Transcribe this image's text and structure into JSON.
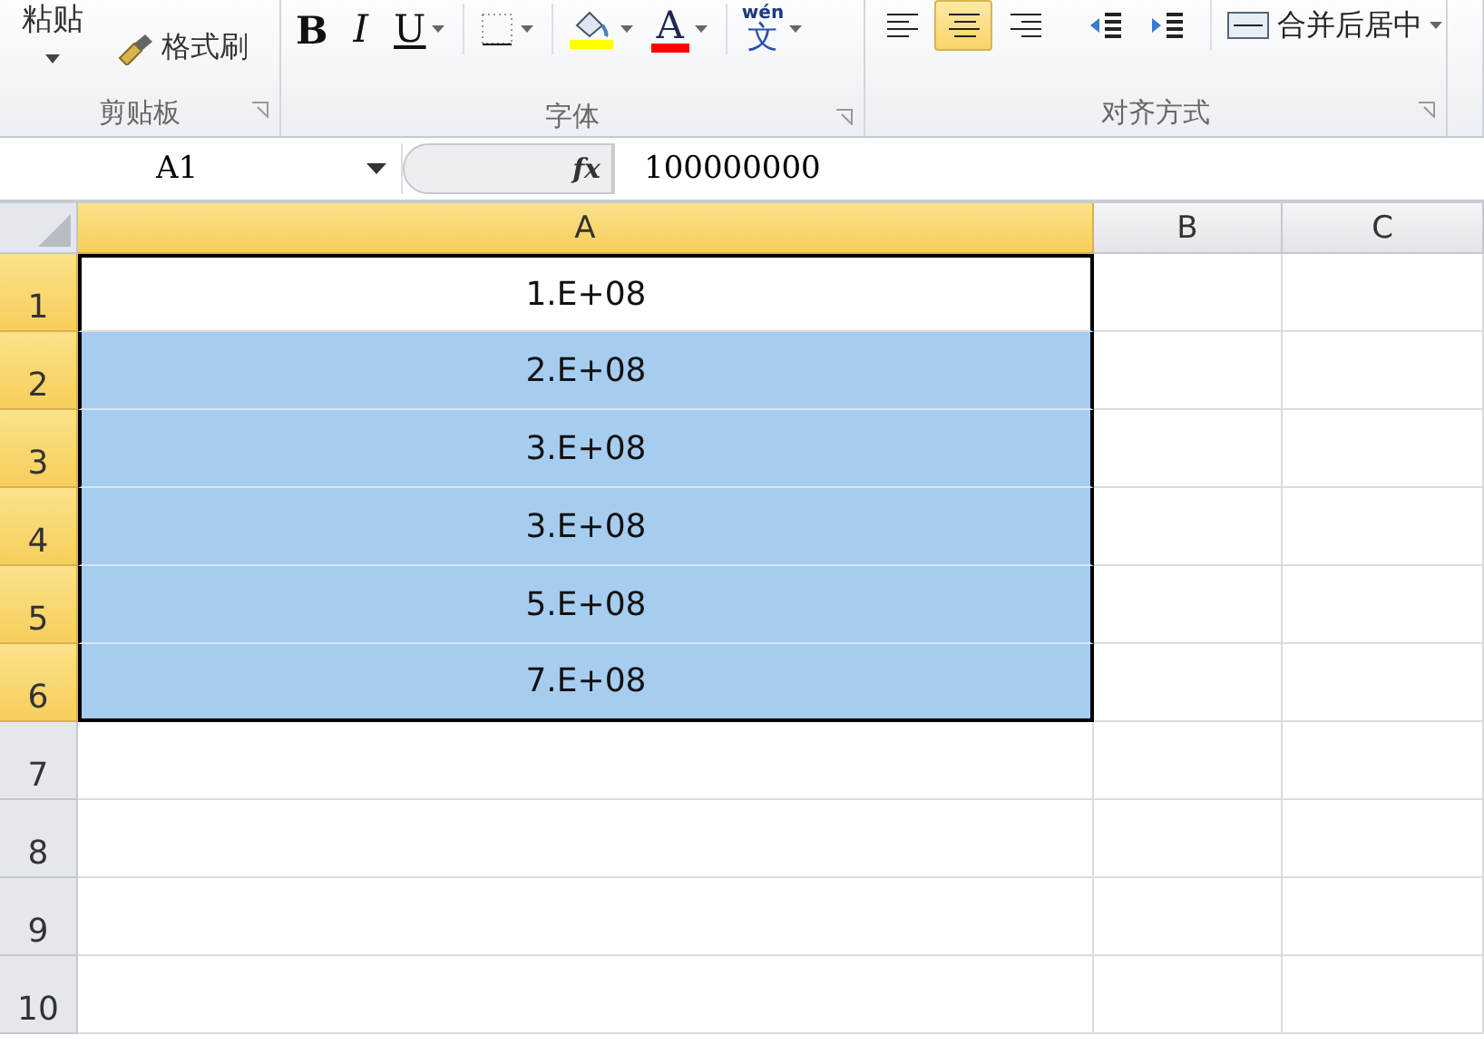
{
  "ribbon": {
    "clipboard": {
      "paste_label": "粘贴",
      "format_painter_label": "格式刷",
      "group_label": "剪贴板"
    },
    "font": {
      "group_label": "字体",
      "buttons": [
        {
          "kind": "bold",
          "label": "B"
        },
        {
          "kind": "italic",
          "label": "I"
        },
        {
          "kind": "underline",
          "label": "U"
        },
        {
          "kind": "border"
        },
        {
          "kind": "fill"
        },
        {
          "kind": "fontcolor",
          "label": "A"
        },
        {
          "kind": "phonetic",
          "label": "文",
          "ruby": "wén"
        }
      ]
    },
    "alignment": {
      "group_label": "对齐方式",
      "merge_label": "合并后居中",
      "buttons": [
        {
          "kind": "left",
          "selected": false
        },
        {
          "kind": "center",
          "selected": true
        },
        {
          "kind": "right",
          "selected": false
        },
        {
          "kind": "outdent",
          "selected": false
        },
        {
          "kind": "indent",
          "selected": false
        }
      ]
    }
  },
  "formula_bar": {
    "name_box": "A1",
    "fx": "fx",
    "value": "100000000"
  },
  "columns": [
    {
      "label": "A",
      "selected": true
    },
    {
      "label": "B",
      "selected": false
    },
    {
      "label": "C",
      "selected": false
    }
  ],
  "rows": [
    {
      "number": "1",
      "selected": true,
      "active": true,
      "cells": [
        "1.E+08"
      ]
    },
    {
      "number": "2",
      "selected": true,
      "active": false,
      "cells": [
        "2.E+08"
      ]
    },
    {
      "number": "3",
      "selected": true,
      "active": false,
      "cells": [
        "3.E+08"
      ]
    },
    {
      "number": "4",
      "selected": true,
      "active": false,
      "cells": [
        "3.E+08"
      ]
    },
    {
      "number": "5",
      "selected": true,
      "active": false,
      "cells": [
        "5.E+08"
      ]
    },
    {
      "number": "6",
      "selected": true,
      "active": false,
      "cells": [
        "7.E+08"
      ]
    },
    {
      "number": "7",
      "selected": false,
      "cells": []
    },
    {
      "number": "8",
      "selected": false,
      "cells": []
    },
    {
      "number": "9",
      "selected": false,
      "cells": []
    },
    {
      "number": "10",
      "selected": false,
      "cells": []
    }
  ]
}
